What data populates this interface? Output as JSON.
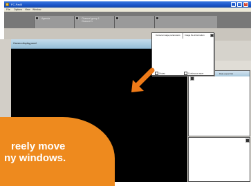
{
  "window": {
    "title": "FC-Pad5",
    "minimize_glyph": "_",
    "maximize_glyph": "□",
    "close_glyph": "×"
  },
  "menu": {
    "items": [
      "File",
      "Options",
      "View",
      "Window"
    ]
  },
  "toolbar": {
    "strips": [
      {
        "text": "Agenda"
      },
      {
        "text": "Channel group 1\nChannel 1"
      },
      {
        "text": ""
      },
      {
        "text": ""
      }
    ]
  },
  "main_panel": {
    "header_label": "Camera display panel"
  },
  "floating_panel": {
    "col_a": "Camera image parameters",
    "col_b": "Image file information",
    "check1": "Output",
    "check2": "Continuous save"
  },
  "right_panel": {
    "header_label": "Data export list"
  },
  "callout": {
    "line1": "reely move",
    "line2": "ny windows."
  },
  "colors": {
    "accent": "#ee8a1e",
    "title_blue": "#1a54c8"
  },
  "icons": [
    "orange-arrow-icon",
    "close-icon",
    "app-icon"
  ]
}
